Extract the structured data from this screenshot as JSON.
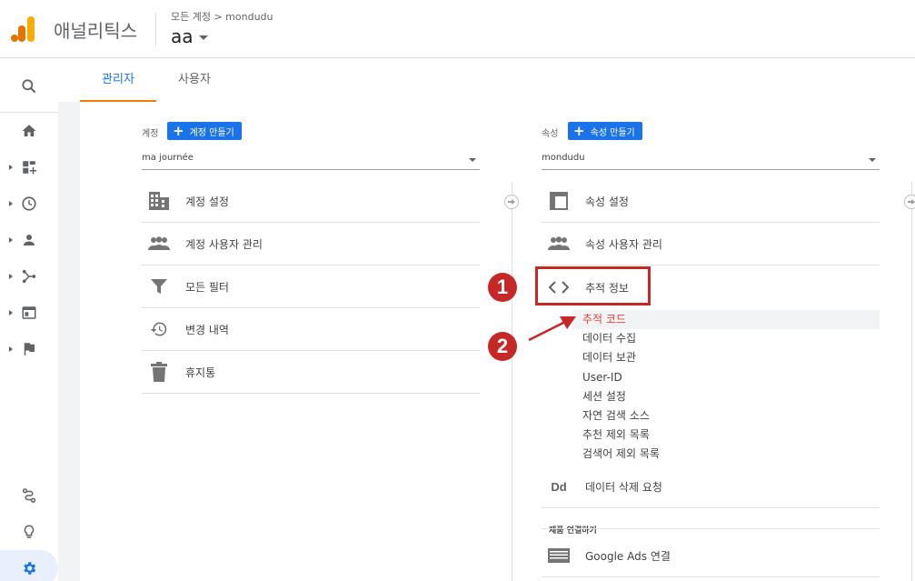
{
  "header": {
    "app_name": "애널리틱스",
    "breadcrumb": "모든 계정 > mondudu",
    "account_name": "aa"
  },
  "tabs": [
    {
      "label": "관리자",
      "active": true
    },
    {
      "label": "사용자",
      "active": false
    }
  ],
  "account_column": {
    "header_label": "계정",
    "create_button": "계정 만들기",
    "selected": "ma journée",
    "items": [
      {
        "label": "계정 설정",
        "icon": "building-icon"
      },
      {
        "label": "계정 사용자 관리",
        "icon": "people-icon"
      },
      {
        "label": "모든 필터",
        "icon": "filter-icon"
      },
      {
        "label": "변경 내역",
        "icon": "history-icon"
      },
      {
        "label": "휴지통",
        "icon": "trash-icon"
      }
    ]
  },
  "property_column": {
    "header_label": "속성",
    "create_button": "속성 만들기",
    "selected": "mondudu",
    "items": [
      {
        "label": "속성 설정",
        "icon": "window-icon"
      },
      {
        "label": "속성 사용자 관리",
        "icon": "people-icon"
      },
      {
        "label": "추적 정보",
        "icon": "code-icon"
      }
    ],
    "tracking_subitems": [
      {
        "label": "추적 코드",
        "active": true
      },
      {
        "label": "데이터 수집"
      },
      {
        "label": "데이터 보관"
      },
      {
        "label": "User-ID"
      },
      {
        "label": "세션 설정"
      },
      {
        "label": "자연 검색 소스"
      },
      {
        "label": "추천 제외 목록"
      },
      {
        "label": "검색어 제외 목록"
      }
    ],
    "data_deletion": "데이터 삭제 요청",
    "data_deletion_icon_text": "Dd",
    "section_label": "제품 연결하기",
    "google_ads": "Google Ads 연결"
  },
  "annotations": {
    "badge_1": "1",
    "badge_2": "2"
  },
  "colors": {
    "accent": "#1a73e8",
    "tab_underline": "#f57c00",
    "active_subitem": "#e8453c",
    "annotation_red": "#c62828"
  }
}
